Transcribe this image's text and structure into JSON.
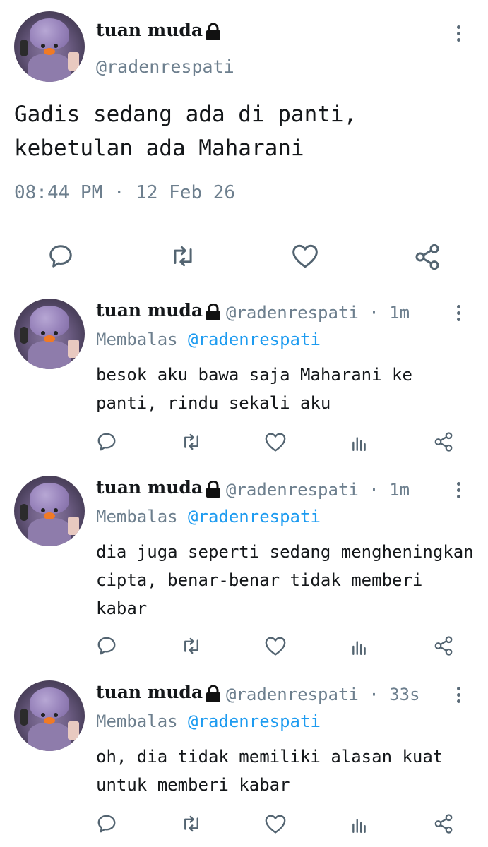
{
  "main_tweet": {
    "name": "tuan muda",
    "handle": "@radenrespati",
    "text": "Gadis sedang ada di panti, kebetulan ada Maharani",
    "timestamp": "08:44 PM · 12 Feb 26"
  },
  "replies": [
    {
      "name": "tuan muda",
      "meta": "@radenrespati · 1m",
      "replying_label": "Membalas",
      "replying_to": "@radenrespati",
      "text": "besok aku bawa saja Maharani ke panti, rindu sekali aku"
    },
    {
      "name": "tuan muda",
      "meta": "@radenrespati · 1m",
      "replying_label": "Membalas",
      "replying_to": "@radenrespati",
      "text": "dia juga seperti sedang mengheningkan cipta, benar-benar tidak memberi kabar"
    },
    {
      "name": "tuan muda",
      "meta": "@radenrespati · 33s",
      "replying_label": "Membalas",
      "replying_to": "@radenrespati",
      "text": "oh, dia tidak memiliki alasan kuat untuk memberi kabar"
    }
  ],
  "colors": {
    "text": "#14171a",
    "secondary": "#6d7f8e",
    "mention": "#1d9bf0",
    "divider": "#e1e8ed"
  },
  "icons": {
    "reply": "reply-icon",
    "retweet": "retweet-icon",
    "like": "heart-icon",
    "views": "views-icon",
    "share": "share-icon",
    "lock": "lock-icon",
    "more": "more-icon"
  }
}
